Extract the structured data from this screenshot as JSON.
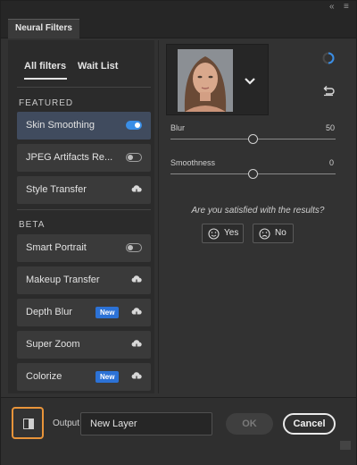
{
  "window": {
    "collapse_glyph": "«",
    "menu_glyph": "≡",
    "tab_label": "Neural Filters"
  },
  "subtabs": [
    {
      "label": "All filters",
      "active": true
    },
    {
      "label": "Wait List",
      "active": false
    }
  ],
  "sections": {
    "featured": "FEATURED",
    "beta": "BETA"
  },
  "filters": {
    "skin_smoothing": {
      "label": "Skin Smoothing",
      "control": "toggle",
      "on": true,
      "selected": true
    },
    "jpeg_artifacts": {
      "label": "JPEG Artifacts Re...",
      "control": "toggle",
      "on": false
    },
    "style_transfer": {
      "label": "Style Transfer",
      "control": "cloud-download-icon"
    },
    "smart_portrait": {
      "label": "Smart Portrait",
      "control": "toggle",
      "on": false
    },
    "makeup_transfer": {
      "label": "Makeup Transfer",
      "control": "cloud-download-icon"
    },
    "depth_blur": {
      "label": "Depth Blur",
      "badge": "New",
      "control": "cloud-download-icon"
    },
    "super_zoom": {
      "label": "Super Zoom",
      "control": "cloud-download-icon"
    },
    "colorize": {
      "label": "Colorize",
      "badge": "New",
      "control": "cloud-download-icon"
    }
  },
  "preview": {
    "icons": [
      "portrait-thumbnail",
      "chevron-down-icon",
      "loading-spinner-icon",
      "reset-icon"
    ]
  },
  "sliders": {
    "blur": {
      "label": "Blur",
      "value": "50",
      "fraction": 0.5
    },
    "smoothness": {
      "label": "Smoothness",
      "value": "0",
      "fraction": 0.5
    }
  },
  "feedback": {
    "question": "Are you satisfied with the results?",
    "yes_label": "Yes",
    "no_label": "No"
  },
  "footer": {
    "output_label": "Output",
    "output_value": "New Layer",
    "ok_label": "OK",
    "cancel_label": "Cancel"
  },
  "colors": {
    "accent": "#3a8ee6",
    "badge": "#2c72d6",
    "highlight_outline": "#e8943a",
    "selected_row": "#404b5e"
  }
}
